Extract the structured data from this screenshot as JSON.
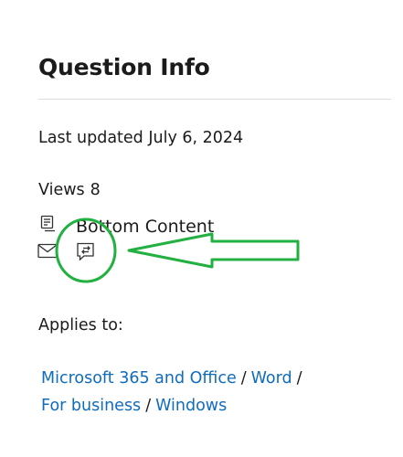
{
  "panel": {
    "title": "Question Info",
    "last_updated": "Last updated July 6, 2024",
    "views_label": "Views",
    "views_count": "8",
    "bottom_content_label": "Bottom Content",
    "applies_to_label": "Applies to:"
  },
  "applies_to": {
    "items": [
      "Microsoft 365 and Office",
      "Word",
      "For business",
      "Windows"
    ],
    "separator": "/"
  },
  "icons": {
    "notes": "notes-icon",
    "mail": "mail-icon",
    "forward_discussion": "forward-discussion-icon"
  },
  "colors": {
    "link": "#0f6cbd",
    "annotation": "#22b040",
    "text": "#1b1b1b"
  }
}
